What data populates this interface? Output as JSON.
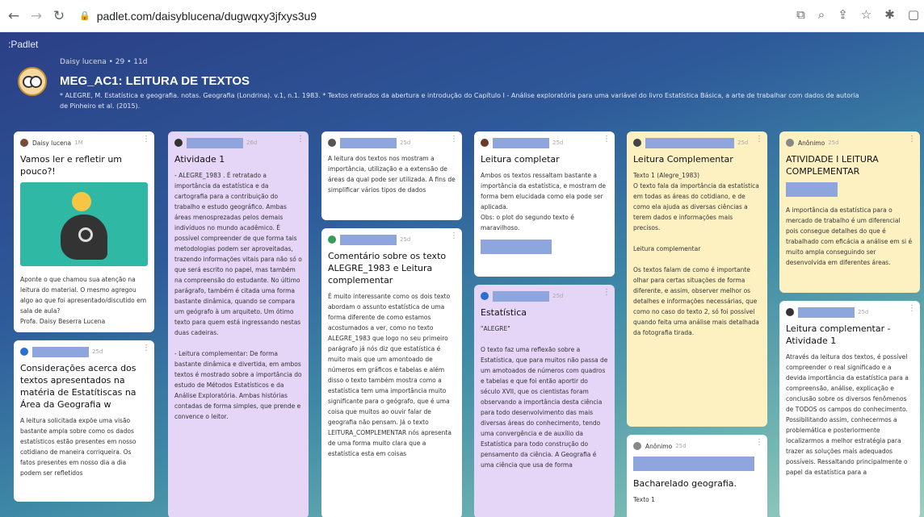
{
  "browser": {
    "url": "padlet.com/daisyblucena/dugwqxy3jfxys3u9"
  },
  "board": {
    "brand": ":Padlet",
    "author_line": "Daisy lucena • 29 • 11d",
    "title": "MEG_AC1: LEITURA DE TEXTOS",
    "description": "* ALEGRE, M. Estatística e geografia. notas. Geografia (Londrina). v.1, n.1. 1983. * Textos retirados da abertura e introdução do Capítulo I - Análise exploratória para uma variável do livro Estatística Básica, a arte de trabalhar com dados de autoria de Pinheiro et al. (2015)."
  },
  "cards": {
    "c1": {
      "author": "Daisy lucena",
      "age": "1M",
      "title": "Vamos ler e refletir um pouco?!",
      "body": "Aponte o que chamou sua atenção na leitura do material. O mesmo agregou algo ao que foi apresentado/discutido em sala de aula?\nProfa. Daisy Beserra Lucena"
    },
    "c2": {
      "age": "25d",
      "title": "Considerações acerca dos textos apresentados na matéria de Estatítiscas na Área da Geografia w",
      "body": "  A leitura solicitada expõe uma visão bastante ampla sobre como os dados estatísticos estão presentes em nosso cotidiano de maneira corriqueira. Os fatos presentes em nosso dia a dia podem ser refletidos"
    },
    "c3": {
      "age": "26d",
      "title": "Atividade 1",
      "body": "- ALEGRE_1983 . É retratado a importância da estatística e da cartografia para a contribuição do trabalho e estudo geográfico. Ambas áreas menosprezadas pelos demais indivíduos no mundo acadêmico. É possível compreender de que forma tais metodologias podem ser aproveitadas, trazendo informações vitais para não só o que será escrito no papel, mas também na compreensão do estudante. No último parágrafo, também é citada uma forma bastante dinâmica, quando se compara um geógrafo à um arquiteto. Um ótimo texto para quem está ingressando nestas duas cadeiras.\n\n- Leitura complementar: De forma bastante dinâmica e divertida, em ambos textos é mostrado sobre a importância do estudo de Métodos Estatísticos e da Análise Exploratória. Ambas histórias contadas de forma simples, que prende e convence o leitor."
    },
    "c4": {
      "age": "25d",
      "body": "A leitura dos textos nos mostram a importância, utilização e a extensão de áreas da qual pode ser utilizada. A fins de simplificar vários tipos de dados"
    },
    "c5": {
      "age": "25d",
      "title": "Comentário sobre os texto ALEGRE_1983 e Leitura complementar",
      "body": "É muito interessante como os dois texto abordam o assunto estatística de uma forma diferente de como estamos acostumados a ver, como no texto ALEGRE_1983 que logo no seu primeiro parágrafo já nós diz que estatística é muito mais que um amontoado de números em gráficos e tabelas e além disso o texto também mostra como a estatística tem uma importância muito significante para o geógrafo, que é uma coisa que muitos ao ouvir falar de geografia não pensam. Já o texto LEITURA_COMPLEMENTAR nós apresenta de uma forma muito clara que a estatística esta em coisas"
    },
    "c6": {
      "age": "25d",
      "title": "Leitura completar",
      "body": "  Ambos os textos ressaltam bastante a importância da estatística, e mostram de forma bem elucidada como ela pode ser aplicada.\n  Obs: o plot do segundo texto é maravilhoso."
    },
    "c7": {
      "age": "25d",
      "title": "Estatística",
      "body": "\"ALEGRE\"\n\nO texto faz uma reflexão sobre a Estatística, que para muitos não passa de um amotoados de números com quadros e tabelas e que foi então aportir do século XVII, que os cientistas foram observando a importância desta ciência para todo desenvolvimento das mais diversas áreas do conhecimento, tendo uma convergência e de auxílio da Estatística para todo construção do pensamento da ciência. A Geografia é uma ciência que usa de forma"
    },
    "c8": {
      "age": "25d",
      "title": "Leitura Complementar",
      "body": "Texto 1 (Alegre_1983)\nO texto fala da importância da estatística em todas as áreas do cotidiano, e de como ela ajuda as diversas ciências a terem dados e informações mais precisos.\n\nLeitura complementar\n\nOs textos falam de como é importante olhar para certas situações de forma diferente, e assim, observer melhor os detalhes e informações necessárias, que como no caso do texto 2, só foi possível quando feita uma análise mais detalhada da fotografia tirada."
    },
    "c9": {
      "author": "Anônimo",
      "age": "25d",
      "title": "Bacharelado geografia.",
      "body": "Texto 1"
    },
    "c10": {
      "author": "Anônimo",
      "age": "25d",
      "title": "ATIVIDADE I  LEITURA COMPLEMENTAR",
      "body": "A importância da estatística para o mercado de trabalho é um diferencial pois consegue detalhes do que é trabalhado com eficácia a análise em si é muito ampla conseguindo ser desenvolvida em diferentes áreas."
    },
    "c11": {
      "age": "25d",
      "title": "Leitura complementar - Atividade 1",
      "body": "Através da leitura dos textos, é possível compreender o real significado e a devida importância da estatística para a compreensão, análise, explicação e conclusão sobre os diversos fenômenos de TODOS os campos do conhecimento. Possibilitando assim, conhecermos a problemática e posteriormente localizarmos a melhor estratégia para trazer as soluções mais adequados possíveis. Ressaltando principalmente o papel da estatística para a"
    }
  }
}
